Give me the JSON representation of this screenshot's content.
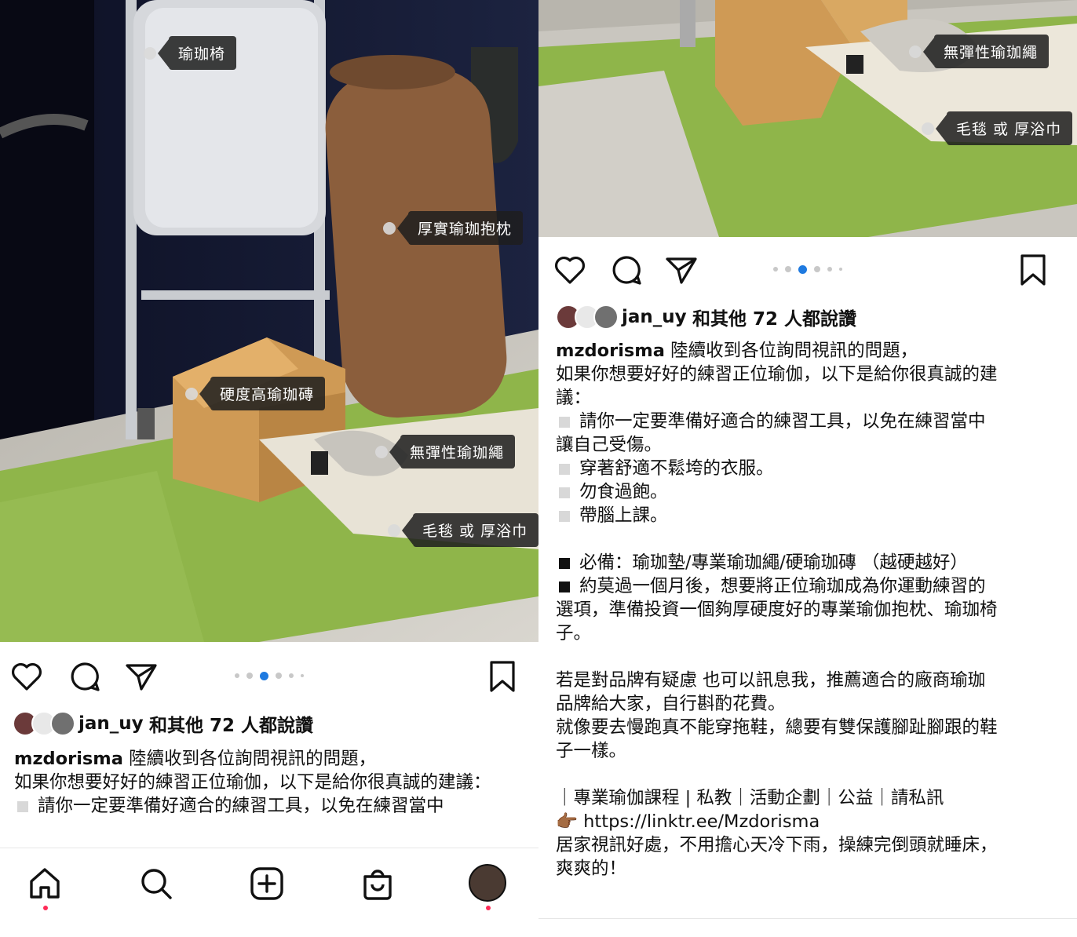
{
  "left": {
    "photo_tags": [
      "瑜珈椅",
      "厚實瑜珈抱枕",
      "硬度高瑜珈磚",
      "無彈性瑜珈繩",
      "毛毯 或 厚浴巾"
    ],
    "likes": {
      "user": "jan_uy",
      "text": "和其他 72 人都說讚"
    },
    "caption": {
      "username": "mzdorisma",
      "line1": "陸續收到各位詢問視訊的問題，",
      "line2": "如果你想要好好的練習正位瑜伽，以下是給你很真誠的建議：",
      "line3": "請你一定要準備好適合的練習工具，以免在練習當中"
    },
    "nav": [
      "home-icon",
      "search-icon",
      "add-post-icon",
      "shop-icon",
      "profile-avatar"
    ]
  },
  "right": {
    "photo_tags": [
      "無彈性瑜珈繩",
      "毛毯 或 厚浴巾"
    ],
    "likes": {
      "user": "jan_uy",
      "text": "和其他 72 人都說讚"
    },
    "caption": {
      "username": "mzdorisma",
      "line1": "陸續收到各位詢問視訊的問題，",
      "line2a": "如果你想要好好的練習正位瑜伽，以下是給你很真誠的建",
      "line2b": "議：",
      "bullet1a": "請你一定要準備好適合的練習工具，以免在練習當中",
      "bullet1b": "讓自己受傷。",
      "bullet2": "穿著舒適不鬆垮的衣服。",
      "bullet3": "勿食過飽。",
      "bullet4": "帶腦上課。",
      "required": "必備：瑜珈墊/專業瑜珈繩/硬瑜珈磚 （越硬越好）",
      "after_month_a": "約莫過一個月後，想要將正位瑜珈成為你運動練習的",
      "after_month_b": "選項，準備投資一個夠厚硬度好的專業瑜伽抱枕、瑜珈椅",
      "after_month_c": "子。",
      "brand_a": "若是對品牌有疑慮 也可以訊息我，推薦適合的廠商瑜珈",
      "brand_b": "品牌給大家，自行斟酌花費。",
      "shoes_a": "就像要去慢跑真不能穿拖鞋，總要有雙保護腳趾腳跟的鞋",
      "shoes_b": "子一樣。",
      "services": "｜專業瑜伽課程 | 私教｜活動企劃｜公益｜請私訊",
      "link": "https://linktr.ee/Mzdorisma",
      "home_a": "居家視訊好處，不用擔心天冷下雨，操練完倒頭就睡床，",
      "home_b": "爽爽的！"
    }
  },
  "colors": {
    "accent_dot": "#1f7ae0",
    "notification": "#ff2a57",
    "mat_green": "#8fb54a"
  }
}
